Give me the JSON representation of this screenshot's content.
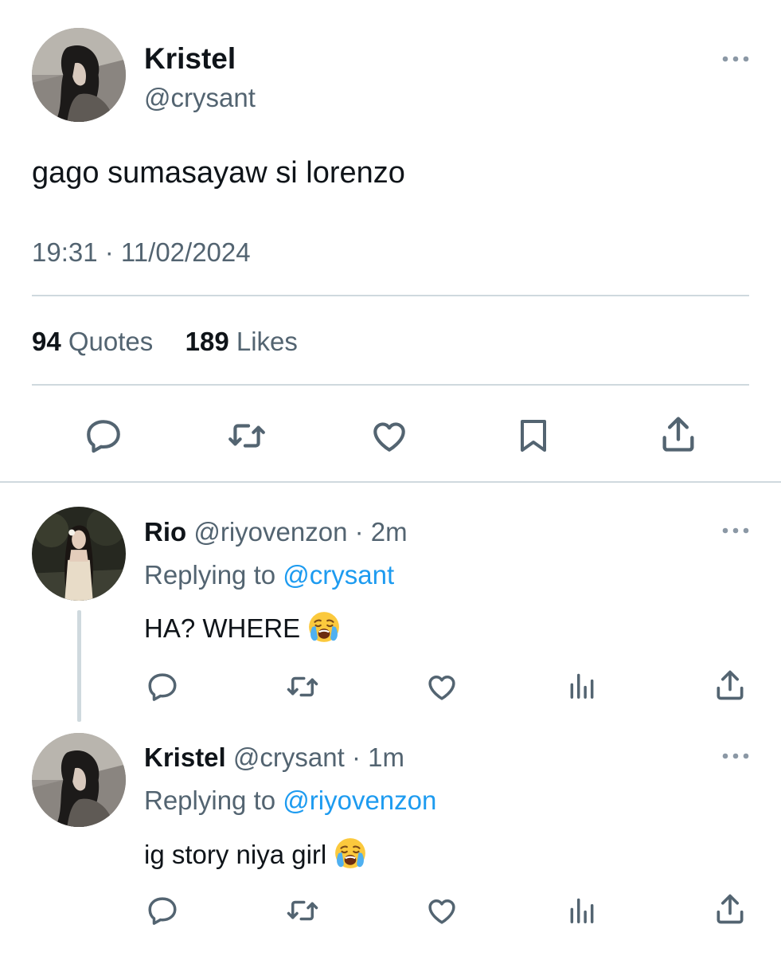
{
  "main_tweet": {
    "display_name": "Kristel",
    "handle": "@crysant",
    "text": "gago sumasayaw si lorenzo",
    "timestamp": "19:31 · 11/02/2024",
    "stats": {
      "quotes_count": "94",
      "quotes_label": "Quotes",
      "likes_count": "189",
      "likes_label": "Likes"
    },
    "actions": [
      "reply",
      "retweet",
      "like",
      "bookmark",
      "share"
    ]
  },
  "replies": [
    {
      "display_name": "Rio",
      "handle": "@riyovenzon",
      "time": "· 2m",
      "replying_prefix": "Replying to",
      "replying_to": "@crysant",
      "text": "HA? WHERE",
      "emoji": "loudly-crying-face",
      "actions": [
        "reply",
        "retweet",
        "like",
        "views",
        "share"
      ]
    },
    {
      "display_name": "Kristel",
      "handle": "@crysant",
      "time": "· 1m",
      "replying_prefix": "Replying to",
      "replying_to": "@riyovenzon",
      "text": "ig story niya girl",
      "emoji": "loudly-crying-face",
      "actions": [
        "reply",
        "retweet",
        "like",
        "views",
        "share"
      ]
    }
  ],
  "colors": {
    "text": "#0f1419",
    "muted": "#536471",
    "link": "#1d9bf0",
    "divider": "#cfd9de",
    "icon": "#536471"
  }
}
